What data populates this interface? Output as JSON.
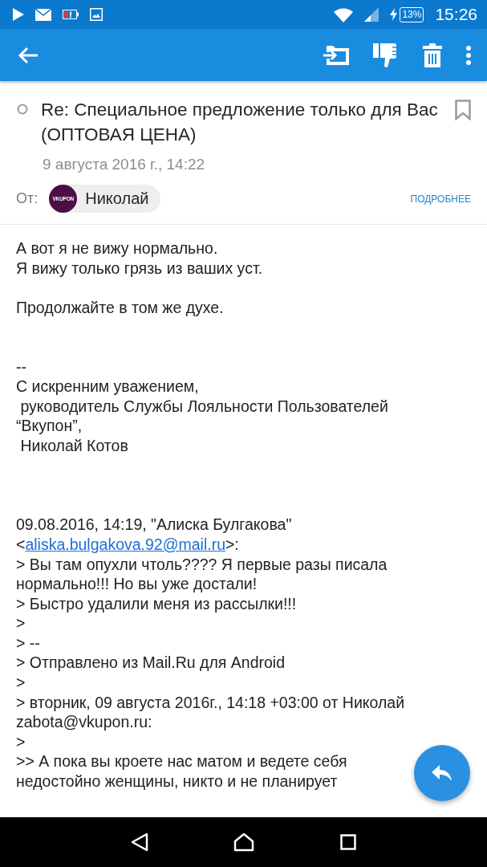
{
  "status_bar": {
    "time": "15:26",
    "battery_text": "13%"
  },
  "header": {
    "subject": "Re: Специальное предложение только для Вас (ОПТОВАЯ ЦЕНА)",
    "date": "9 августа 2016 г., 14:22",
    "from_label": "От:",
    "sender": {
      "name": "Николай",
      "avatar_text": "VKUPON"
    },
    "details_link": "ПОДРОБНЕЕ"
  },
  "body": [
    {
      "kind": "text",
      "text": "А вот я не вижу нормально."
    },
    {
      "kind": "text",
      "text": "Я вижу только грязь из ваших уст."
    },
    {
      "kind": "blank"
    },
    {
      "kind": "text",
      "text": "Продолжайте в том же духе."
    },
    {
      "kind": "blank"
    },
    {
      "kind": "blank"
    },
    {
      "kind": "text",
      "text": "--"
    },
    {
      "kind": "text",
      "text": "С искренним уважением,"
    },
    {
      "kind": "text",
      "text": " руководитель Службы Лояльности Пользователей"
    },
    {
      "kind": "text",
      "text": "“Вкупон”,"
    },
    {
      "kind": "text",
      "text": " Николай Котов"
    },
    {
      "kind": "blank"
    },
    {
      "kind": "blank"
    },
    {
      "kind": "blank"
    },
    {
      "kind": "text",
      "text": "09.08.2016, 14:19, \"Алиска Булгакова\""
    },
    {
      "kind": "link",
      "before": "<",
      "link": "aliska.bulgakova.92@mail.ru",
      "after": ">:"
    },
    {
      "kind": "text",
      "text": "> Вы там опухли чтоль???? Я первые разы писала"
    },
    {
      "kind": "text",
      "text": "нормально!!! Но вы уже достали!"
    },
    {
      "kind": "text",
      "text": "> Быстро удалили меня из рассылки!!!"
    },
    {
      "kind": "text",
      "text": ">"
    },
    {
      "kind": "text",
      "text": "> --"
    },
    {
      "kind": "text",
      "text": "> Отправлено из Mail.Ru для Android"
    },
    {
      "kind": "text",
      "text": ">"
    },
    {
      "kind": "text",
      "text": "> вторник, 09 августа 2016г., 14:18 +03:00 от Николай"
    },
    {
      "kind": "text",
      "text": "zabota@vkupon.ru:"
    },
    {
      "kind": "text",
      "text": ">"
    },
    {
      "kind": "text",
      "text": ">> А пока вы кроете нас матом и ведете себя"
    },
    {
      "kind": "text",
      "text": "недостойно женщины, никто и не планирует"
    }
  ]
}
